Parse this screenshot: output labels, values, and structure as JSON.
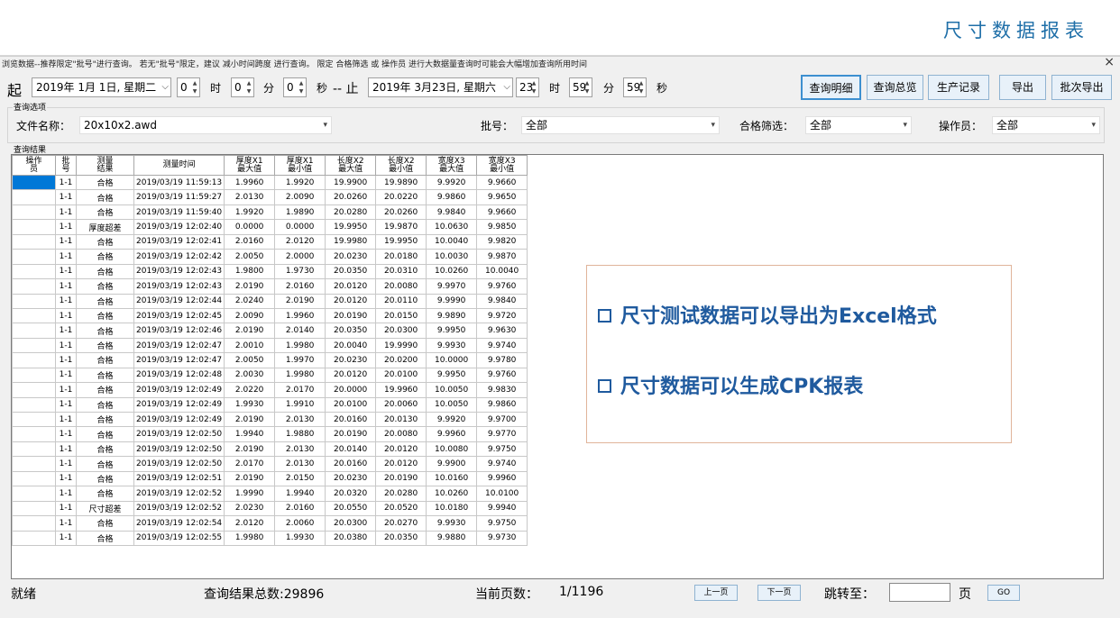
{
  "header": {
    "title": "尺寸数据报表"
  },
  "notice": "浏览数据--推荐限定\"批号\"进行查询。    若无\"批号\"限定，建议 减小时间跨度 进行查询。    限定 合格筛选 或 操作员 进行大数据量查询时可能会大幅增加查询所用时间",
  "close_label": "×",
  "range": {
    "start_label": "起",
    "start_date": "2019年  1月  1日, 星期二",
    "start_h": "0",
    "start_m": "0",
    "start_s": "0",
    "sep": "-- 止",
    "end_date": "2019年  3月23日, 星期六",
    "end_h": "23",
    "end_m": "59",
    "end_s": "59",
    "unit_h": "时",
    "unit_m": "分",
    "unit_s": "秒"
  },
  "buttons": {
    "detail": "查询明细",
    "summary": "查询总览",
    "production": "生产记录",
    "export": "导出",
    "batch_export": "批次导出"
  },
  "options": {
    "group_title": "查询选项",
    "file_label": "文件名称：",
    "file_value": "20x10x2.awd",
    "batch_label": "批号：",
    "batch_value": "全部",
    "pass_label": "合格筛选：",
    "pass_value": "全部",
    "operator_label": "操作员：",
    "operator_value": "全部"
  },
  "results": {
    "group_title": "查询结果",
    "columns": [
      [
        "操作",
        "员"
      ],
      [
        "批",
        "号"
      ],
      [
        "测量",
        "结果"
      ],
      [
        "测量时间",
        ""
      ],
      [
        "厚度X1",
        "最大值"
      ],
      [
        "厚度X1",
        "最小值"
      ],
      [
        "长度X2",
        "最大值"
      ],
      [
        "长度X2",
        "最小值"
      ],
      [
        "宽度X3",
        "最大值"
      ],
      [
        "宽度X3",
        "最小值"
      ]
    ],
    "rows": [
      [
        "",
        "1-1",
        "合格",
        "2019/03/19 11:59:13",
        "1.9960",
        "1.9920",
        "19.9900",
        "19.9890",
        "9.9920",
        "9.9660"
      ],
      [
        "",
        "1-1",
        "合格",
        "2019/03/19 11:59:27",
        "2.0130",
        "2.0090",
        "20.0260",
        "20.0220",
        "9.9860",
        "9.9650"
      ],
      [
        "",
        "1-1",
        "合格",
        "2019/03/19 11:59:40",
        "1.9920",
        "1.9890",
        "20.0280",
        "20.0260",
        "9.9840",
        "9.9660"
      ],
      [
        "",
        "1-1",
        "厚度超差",
        "2019/03/19 12:02:40",
        "0.0000",
        "0.0000",
        "19.9950",
        "19.9870",
        "10.0630",
        "9.9850"
      ],
      [
        "",
        "1-1",
        "合格",
        "2019/03/19 12:02:41",
        "2.0160",
        "2.0120",
        "19.9980",
        "19.9950",
        "10.0040",
        "9.9820"
      ],
      [
        "",
        "1-1",
        "合格",
        "2019/03/19 12:02:42",
        "2.0050",
        "2.0000",
        "20.0230",
        "20.0180",
        "10.0030",
        "9.9870"
      ],
      [
        "",
        "1-1",
        "合格",
        "2019/03/19 12:02:43",
        "1.9800",
        "1.9730",
        "20.0350",
        "20.0310",
        "10.0260",
        "10.0040"
      ],
      [
        "",
        "1-1",
        "合格",
        "2019/03/19 12:02:43",
        "2.0190",
        "2.0160",
        "20.0120",
        "20.0080",
        "9.9970",
        "9.9760"
      ],
      [
        "",
        "1-1",
        "合格",
        "2019/03/19 12:02:44",
        "2.0240",
        "2.0190",
        "20.0120",
        "20.0110",
        "9.9990",
        "9.9840"
      ],
      [
        "",
        "1-1",
        "合格",
        "2019/03/19 12:02:45",
        "2.0090",
        "1.9960",
        "20.0190",
        "20.0150",
        "9.9890",
        "9.9720"
      ],
      [
        "",
        "1-1",
        "合格",
        "2019/03/19 12:02:46",
        "2.0190",
        "2.0140",
        "20.0350",
        "20.0300",
        "9.9950",
        "9.9630"
      ],
      [
        "",
        "1-1",
        "合格",
        "2019/03/19 12:02:47",
        "2.0010",
        "1.9980",
        "20.0040",
        "19.9990",
        "9.9930",
        "9.9740"
      ],
      [
        "",
        "1-1",
        "合格",
        "2019/03/19 12:02:47",
        "2.0050",
        "1.9970",
        "20.0230",
        "20.0200",
        "10.0000",
        "9.9780"
      ],
      [
        "",
        "1-1",
        "合格",
        "2019/03/19 12:02:48",
        "2.0030",
        "1.9980",
        "20.0120",
        "20.0100",
        "9.9950",
        "9.9760"
      ],
      [
        "",
        "1-1",
        "合格",
        "2019/03/19 12:02:49",
        "2.0220",
        "2.0170",
        "20.0000",
        "19.9960",
        "10.0050",
        "9.9830"
      ],
      [
        "",
        "1-1",
        "合格",
        "2019/03/19 12:02:49",
        "1.9930",
        "1.9910",
        "20.0100",
        "20.0060",
        "10.0050",
        "9.9860"
      ],
      [
        "",
        "1-1",
        "合格",
        "2019/03/19 12:02:49",
        "2.0190",
        "2.0130",
        "20.0160",
        "20.0130",
        "9.9920",
        "9.9700"
      ],
      [
        "",
        "1-1",
        "合格",
        "2019/03/19 12:02:50",
        "1.9940",
        "1.9880",
        "20.0190",
        "20.0080",
        "9.9960",
        "9.9770"
      ],
      [
        "",
        "1-1",
        "合格",
        "2019/03/19 12:02:50",
        "2.0190",
        "2.0130",
        "20.0140",
        "20.0120",
        "10.0080",
        "9.9750"
      ],
      [
        "",
        "1-1",
        "合格",
        "2019/03/19 12:02:50",
        "2.0170",
        "2.0130",
        "20.0160",
        "20.0120",
        "9.9900",
        "9.9740"
      ],
      [
        "",
        "1-1",
        "合格",
        "2019/03/19 12:02:51",
        "2.0190",
        "2.0150",
        "20.0230",
        "20.0190",
        "10.0160",
        "9.9960"
      ],
      [
        "",
        "1-1",
        "合格",
        "2019/03/19 12:02:52",
        "1.9990",
        "1.9940",
        "20.0320",
        "20.0280",
        "10.0260",
        "10.0100"
      ],
      [
        "",
        "1-1",
        "尺寸超差",
        "2019/03/19 12:02:52",
        "2.0230",
        "2.0160",
        "20.0550",
        "20.0520",
        "10.0180",
        "9.9940"
      ],
      [
        "",
        "1-1",
        "合格",
        "2019/03/19 12:02:54",
        "2.0120",
        "2.0060",
        "20.0300",
        "20.0270",
        "9.9930",
        "9.9750"
      ],
      [
        "",
        "1-1",
        "合格",
        "2019/03/19 12:02:55",
        "1.9980",
        "1.9930",
        "20.0380",
        "20.0350",
        "9.9880",
        "9.9730"
      ]
    ]
  },
  "callout": {
    "line1": "尺寸测试数据可以导出为Excel格式",
    "line2": "尺寸数据可以生成CPK报表"
  },
  "status": {
    "ready": "就绪",
    "total": "查询结果总数:29896",
    "page_label": "当前页数：",
    "page_value": "1/1196",
    "prev": "上一页",
    "next": "下一页",
    "jump_label": "跳转至：",
    "jump_unit": "页",
    "go": "GO"
  }
}
